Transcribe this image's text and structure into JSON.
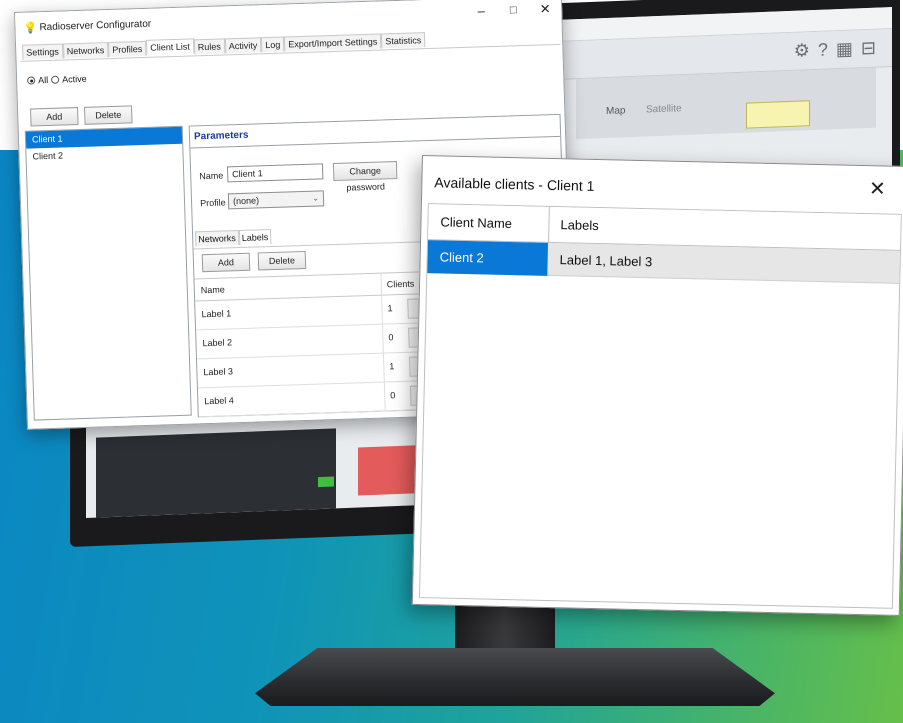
{
  "colors": {
    "selection_blue": "#0a78d7",
    "params_title": "#1b3b9b",
    "bg_gradient_start": "#0a86c4",
    "bg_gradient_end": "#66bf4a"
  },
  "monitor": {
    "toolbar_icons": [
      "gear-icon",
      "help-icon",
      "grid-icon",
      "layout-icon"
    ],
    "toolbar_glyphs": [
      "⚙",
      "?",
      "▦",
      "⊟"
    ],
    "map_tab_1": "Map",
    "map_tab_2": "Satellite"
  },
  "configurator": {
    "title": "Radioserver Configurator",
    "window_controls": {
      "minimize": "–",
      "maximize": "□",
      "close": "✕"
    },
    "tabs": [
      "Settings",
      "Networks",
      "Profiles",
      "Client List",
      "Rules",
      "Activity",
      "Log",
      "Export/Import Settings",
      "Statistics"
    ],
    "active_tab": "Client List",
    "filter": {
      "all": "All",
      "active": "Active"
    },
    "add_button": "Add",
    "delete_button": "Delete",
    "clients": [
      "Client 1",
      "Client 2"
    ],
    "parameters": {
      "title": "Parameters",
      "name_label": "Name",
      "name_value": "Client 1",
      "change_password": "Change password",
      "profile_label": "Profile",
      "profile_value": "(none)",
      "subtabs": [
        "Networks",
        "Labels"
      ],
      "labels_add": "Add",
      "labels_delete": "Delete",
      "table_headers": {
        "name": "Name",
        "clients": "Clients"
      },
      "labels": [
        {
          "name": "Label 1",
          "count": "1"
        },
        {
          "name": "Label 2",
          "count": "0"
        },
        {
          "name": "Label 3",
          "count": "1"
        },
        {
          "name": "Label 4",
          "count": "0"
        }
      ]
    }
  },
  "dialog": {
    "title": "Available clients - Client 1",
    "close": "✕",
    "headers": {
      "client_name": "Client Name",
      "labels": "Labels"
    },
    "rows": [
      {
        "client_name": "Client 2",
        "labels": "Label 1, Label 3"
      }
    ]
  }
}
